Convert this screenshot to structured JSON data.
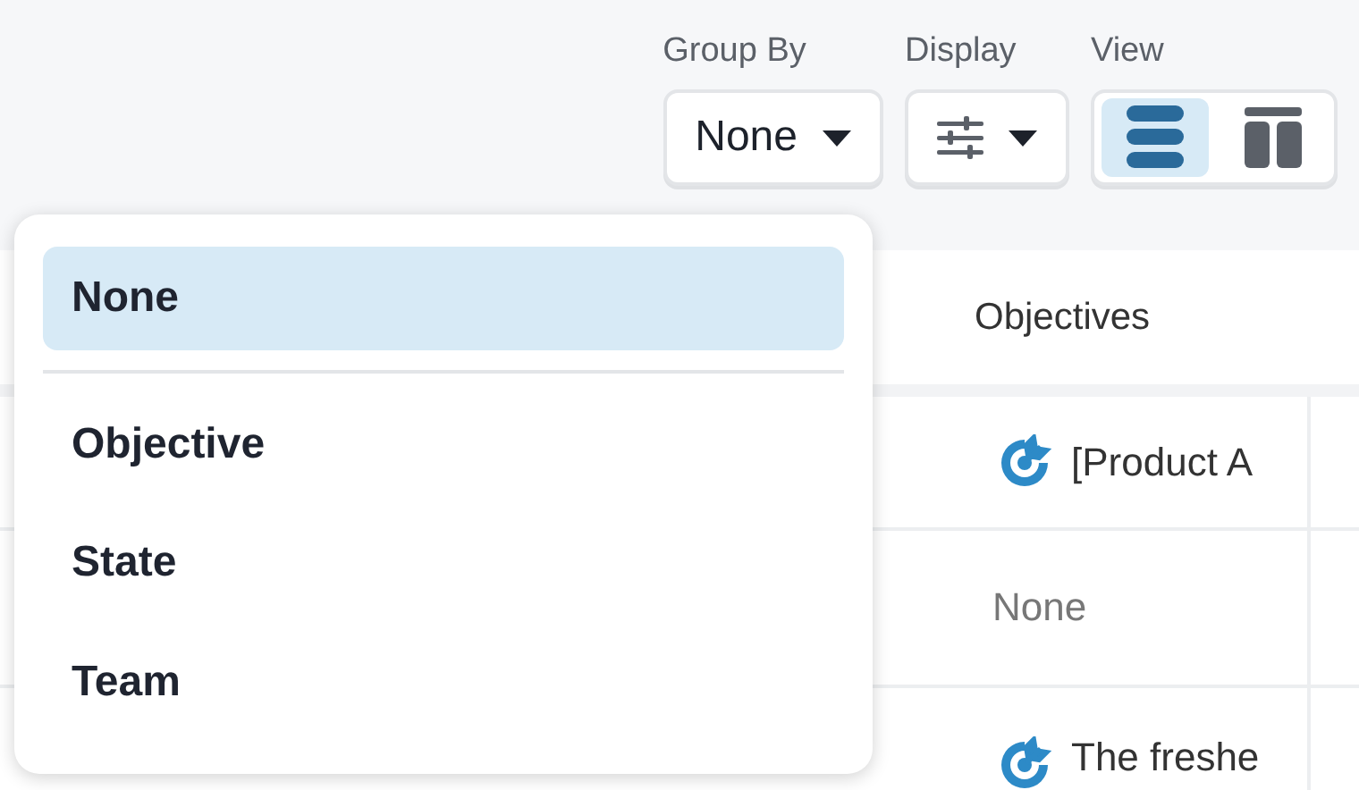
{
  "toolbar": {
    "group_by": {
      "label": "Group By",
      "value": "None"
    },
    "display": {
      "label": "Display"
    },
    "view": {
      "label": "View",
      "options": [
        {
          "kind": "list",
          "selected": true
        },
        {
          "kind": "board",
          "selected": false
        }
      ]
    }
  },
  "table": {
    "columns": [
      {
        "label": "Objectives"
      }
    ],
    "rows": [
      {
        "objective": {
          "kind": "objective",
          "text": "[Product A"
        }
      },
      {
        "objective": {
          "kind": "none",
          "text": "None"
        }
      },
      {
        "objective": {
          "kind": "objective",
          "text": "The freshe"
        }
      }
    ]
  },
  "group_menu": {
    "items": [
      {
        "label": "None",
        "selected": true
      },
      {
        "label": "Objective",
        "selected": false
      },
      {
        "label": "State",
        "selected": false
      },
      {
        "label": "Team",
        "selected": false
      }
    ]
  }
}
